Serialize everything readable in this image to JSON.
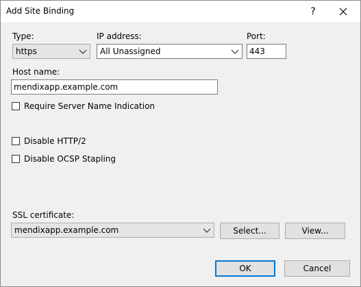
{
  "window": {
    "title": "Add Site Binding",
    "help_label": "?"
  },
  "type": {
    "label": "Type:",
    "value": "https"
  },
  "ip": {
    "label": "IP address:",
    "value": "All Unassigned"
  },
  "port": {
    "label": "Port:",
    "value": "443"
  },
  "host": {
    "label": "Host name:",
    "value": "mendixapp.example.com"
  },
  "options": {
    "sni_label": "Require Server Name Indication",
    "http2_label": "Disable HTTP/2",
    "ocsp_label": "Disable OCSP Stapling"
  },
  "ssl": {
    "label": "SSL certificate:",
    "value": "mendixapp.example.com",
    "select_label": "Select...",
    "view_label": "View..."
  },
  "footer": {
    "ok_label": "OK",
    "cancel_label": "Cancel"
  },
  "icons": {
    "close": "close-icon",
    "dropdown": "chevron-down-icon"
  },
  "colors": {
    "accent": "#0078d7",
    "dialog_bg": "#f0f0f0",
    "button_bg": "#e1e1e1"
  }
}
